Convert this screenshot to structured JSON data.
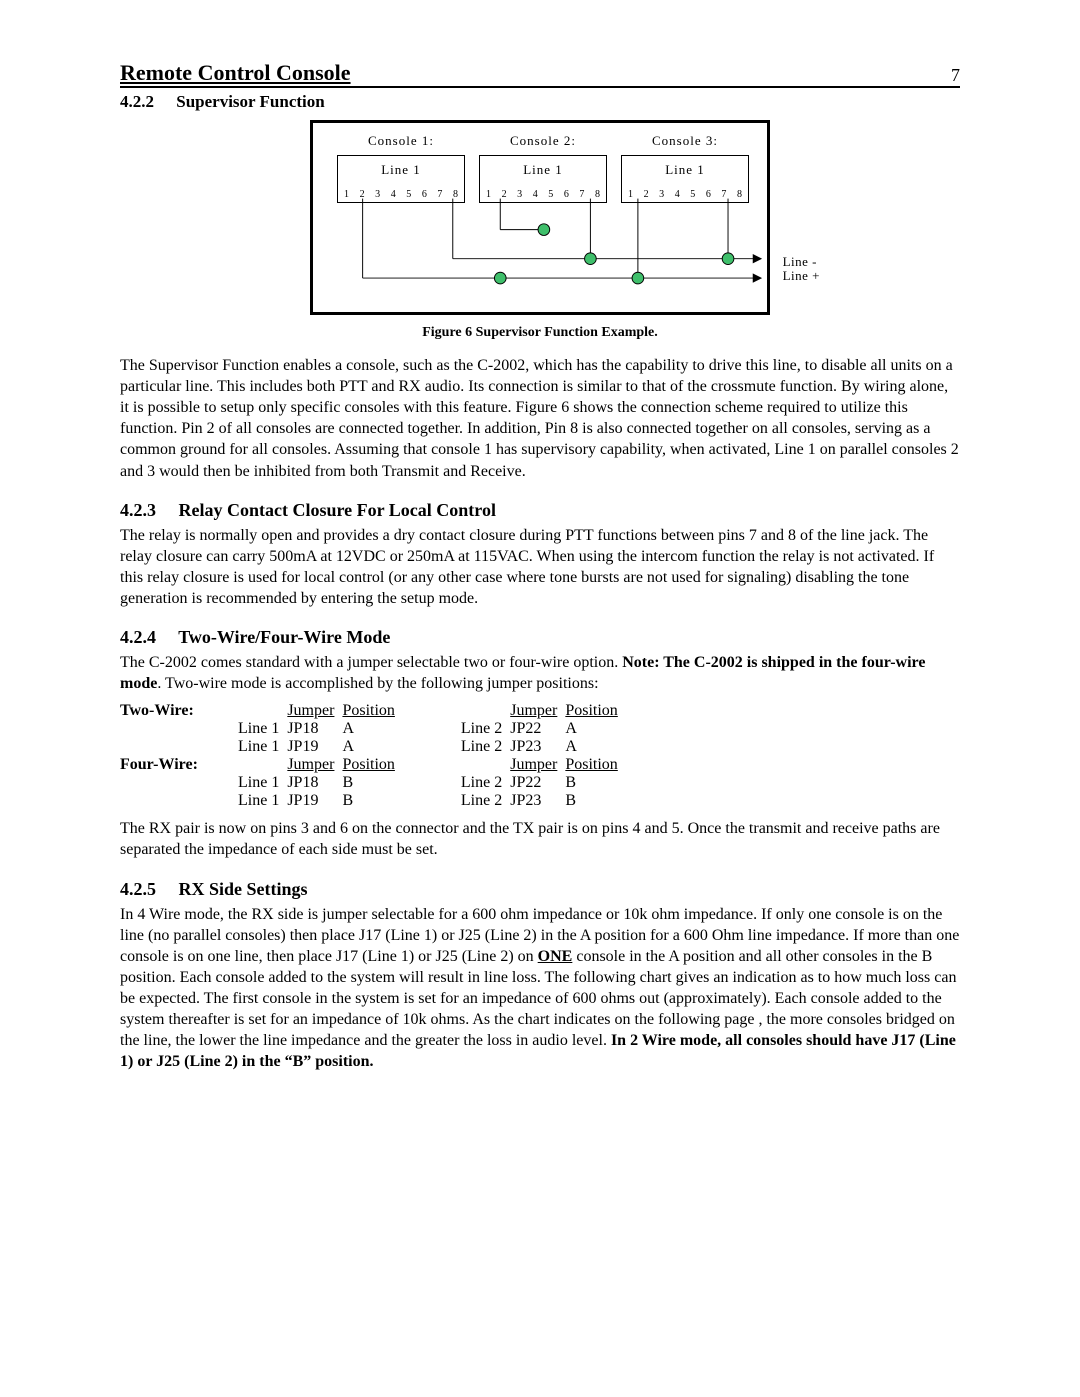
{
  "header": {
    "title": "Remote Control Console",
    "page": "7"
  },
  "section_422": {
    "num": "4.2.2",
    "title": "Supervisor Function"
  },
  "diagram": {
    "consoles": [
      {
        "title": "Console 1:",
        "line": "Line 1",
        "pins": [
          "1",
          "2",
          "3",
          "4",
          "5",
          "6",
          "7",
          "8"
        ]
      },
      {
        "title": "Console 2:",
        "line": "Line 1",
        "pins": [
          "1",
          "2",
          "3",
          "4",
          "5",
          "6",
          "7",
          "8"
        ]
      },
      {
        "title": "Console 3:",
        "line": "Line 1",
        "pins": [
          "1",
          "2",
          "3",
          "4",
          "5",
          "6",
          "7",
          "8"
        ]
      }
    ],
    "ext_minus": "Line -",
    "ext_plus": "Line +"
  },
  "figure_caption": "Figure 6 Supervisor Function Example.",
  "para_422": "The Supervisor Function enables a console, such as the C-2002, which has the capability to drive this line, to disable all units on a particular line.  This includes both PTT and RX audio.  Its connection is similar to that of the crossmute function.  By wiring alone, it is possible to setup only specific consoles with this feature.  Figure 6 shows the connection scheme required to utilize this function.  Pin 2 of all consoles are connected together.  In addition, Pin 8 is also connected together on all consoles, serving as a common ground for all consoles.  Assuming that console 1 has supervisory capability, when activated, Line 1 on parallel consoles 2 and 3 would then be inhibited from both Transmit and Receive.",
  "section_423": {
    "num": "4.2.3",
    "title": "Relay Contact Closure For Local Control",
    "para": "The relay is normally open and provides a dry contact closure during PTT functions between pins 7 and 8 of the line jack.  The relay closure can carry 500mA at 12VDC or 250mA at 115VAC.  When using the intercom function the relay is not activated.  If this relay closure is used for local control (or any other case where tone bursts are not used for signaling) disabling the tone generation is recommended by entering the setup mode."
  },
  "section_424": {
    "num": "4.2.4",
    "title": "Two-Wire/Four-Wire Mode",
    "lead_a": "The C-2002 comes standard with a jumper selectable two or four-wire option.  ",
    "lead_note": "Note: The C-2002 is shipped in the four-wire mode",
    "lead_b": ".  Two-wire mode is accomplished by the following jumper positions:",
    "labels": {
      "two_wire": "Two-Wire:",
      "four_wire": "Four-Wire:",
      "jumper": "Jumper",
      "position": "Position"
    },
    "two_wire_rows": [
      {
        "l1": "Line 1",
        "j1": "JP18",
        "p1": "A",
        "l2": "Line 2",
        "j2": "JP22",
        "p2": "A"
      },
      {
        "l1": "Line 1",
        "j1": "JP19",
        "p1": "A",
        "l2": "Line 2",
        "j2": "JP23",
        "p2": "A"
      }
    ],
    "four_wire_rows": [
      {
        "l1": "Line 1",
        "j1": "JP18",
        "p1": "B",
        "l2": "Line 2",
        "j2": "JP22",
        "p2": "B"
      },
      {
        "l1": "Line 1",
        "j1": "JP19",
        "p1": "B",
        "l2": "Line 2",
        "j2": "JP23",
        "p2": "B"
      }
    ],
    "trail": "The RX pair is now on pins 3 and 6 on the connector and the TX pair is on pins 4 and 5.  Once the transmit and receive paths are separated the impedance of each side must be set."
  },
  "section_425": {
    "num": "4.2.5",
    "title": "RX Side Settings",
    "para_a": "In 4 Wire mode, the RX side is jumper selectable for a 600 ohm impedance or 10k ohm impedance.  If only one console is on the line (no parallel consoles) then place J17 (Line 1) or J25 (Line 2) in the A position for a 600 Ohm line impedance.  If more than one console is on one line, then place J17 (Line 1) or J25 (Line 2) on ",
    "one_word": "ONE",
    "para_b": " console in the A position and all other consoles in the B position.  Each console added to the system will result in line loss.  The following chart gives an indication as to how much loss can be expected.  The first console in the system is set for an impedance of 600 ohms out (approximately).  Each console added to the system thereafter is set for an impedance of 10k ohms.  As the chart indicates on the following page , the more consoles bridged on the line, the lower the line impedance and the greater the loss in audio level. ",
    "bold_tail": "In 2 Wire mode, all consoles should have J17 (Line 1) or J25 (Line 2) in the “B” position."
  }
}
